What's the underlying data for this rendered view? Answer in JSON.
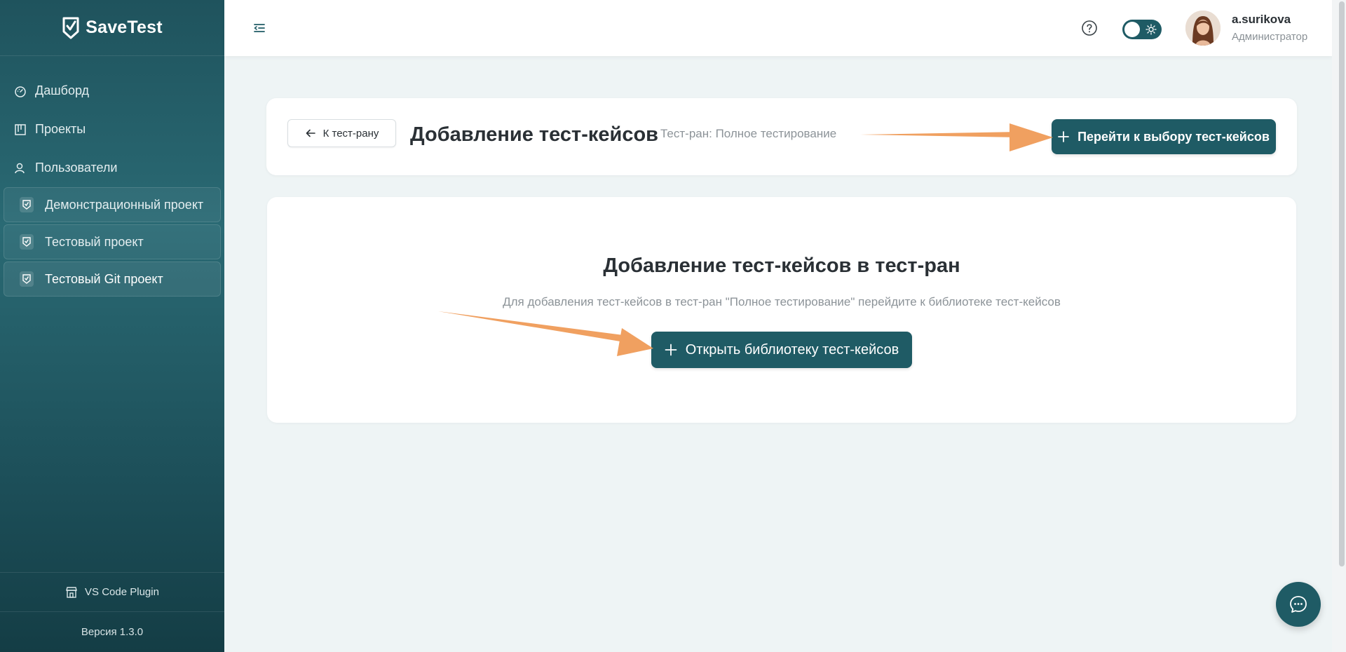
{
  "brand": {
    "name": "SaveTest"
  },
  "sidebar": {
    "nav": [
      {
        "label": "Дашборд",
        "icon": "dashboard-icon"
      },
      {
        "label": "Проекты",
        "icon": "projects-icon"
      },
      {
        "label": "Пользователи",
        "icon": "users-icon"
      }
    ],
    "projects": [
      {
        "label": "Демонстрационный проект",
        "icon": "project-icon"
      },
      {
        "label": "Тестовый проект",
        "icon": "project-icon"
      },
      {
        "label": "Тестовый Git проект",
        "icon": "project-icon",
        "active": true
      }
    ],
    "plugin_label": "VS Code Plugin",
    "version": "Версия 1.3.0"
  },
  "topbar": {
    "user_name": "a.surikova",
    "user_role": "Администратор",
    "theme": "light"
  },
  "header": {
    "back_label": "К тест-рану",
    "title": "Добавление тест-кейсов",
    "subtitle": "Тест-ран: Полное тестирование",
    "select_button": "Перейти к выбору тест-кейсов"
  },
  "empty_state": {
    "title": "Добавление тест-кейсов в тест-ран",
    "description": "Для добавления тест-кейсов в тест-ран \"Полное тестирование\" перейдите к библиотеке тест-кейсов",
    "open_button": "Открыть библиотеку тест-кейсов"
  },
  "colors": {
    "accent": "#1f5b65",
    "arrow": "#f0a060",
    "background": "#eef4f5"
  }
}
